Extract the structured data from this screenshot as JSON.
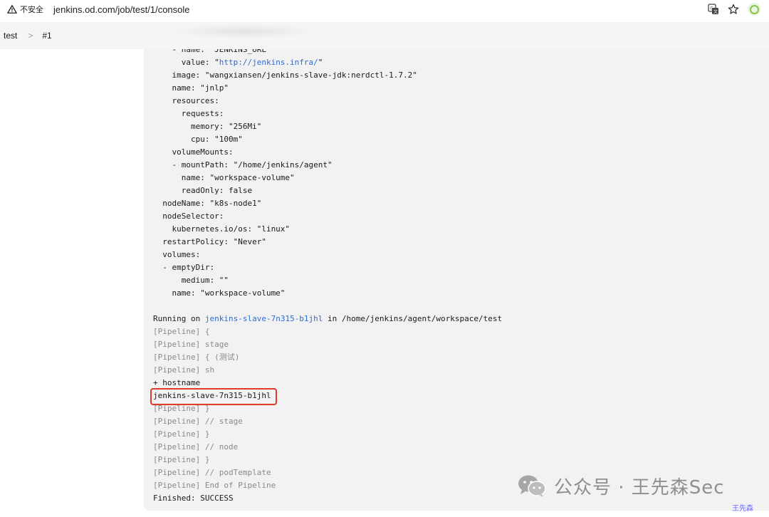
{
  "browser": {
    "security_label": "不安全",
    "url": "jenkins.od.com/job/test/1/console",
    "icons": [
      "warning-icon",
      "translate-icon",
      "star-icon",
      "profile-icon"
    ]
  },
  "breadcrumb": {
    "items": [
      "test",
      "#1"
    ],
    "separator": ">"
  },
  "console": {
    "lines": [
      {
        "text": "    - name: \"JENKINS_URL\"",
        "kind": "normal"
      },
      {
        "text_pre": "      value: \"",
        "link": "http://jenkins.infra/",
        "text_post": "\"",
        "kind": "link"
      },
      {
        "text": "    image: \"wangxiansen/jenkins-slave-jdk:nerdctl-1.7.2\"",
        "kind": "normal"
      },
      {
        "text": "    name: \"jnlp\"",
        "kind": "normal"
      },
      {
        "text": "    resources:",
        "kind": "normal"
      },
      {
        "text": "      requests:",
        "kind": "normal"
      },
      {
        "text": "        memory: \"256Mi\"",
        "kind": "normal"
      },
      {
        "text": "        cpu: \"100m\"",
        "kind": "normal"
      },
      {
        "text": "    volumeMounts:",
        "kind": "normal"
      },
      {
        "text": "    - mountPath: \"/home/jenkins/agent\"",
        "kind": "normal"
      },
      {
        "text": "      name: \"workspace-volume\"",
        "kind": "normal"
      },
      {
        "text": "      readOnly: false",
        "kind": "normal"
      },
      {
        "text": "  nodeName: \"k8s-node1\"",
        "kind": "normal"
      },
      {
        "text": "  nodeSelector:",
        "kind": "normal"
      },
      {
        "text": "    kubernetes.io/os: \"linux\"",
        "kind": "normal"
      },
      {
        "text": "  restartPolicy: \"Never\"",
        "kind": "normal"
      },
      {
        "text": "  volumes:",
        "kind": "normal"
      },
      {
        "text": "  - emptyDir:",
        "kind": "normal"
      },
      {
        "text": "      medium: \"\"",
        "kind": "normal"
      },
      {
        "text": "    name: \"workspace-volume\"",
        "kind": "normal"
      },
      {
        "text": "",
        "kind": "normal"
      },
      {
        "text_pre": "Running on ",
        "link": "jenkins-slave-7n315-b1jhl",
        "text_post": " in /home/jenkins/agent/workspace/test",
        "kind": "link"
      },
      {
        "text": "[Pipeline] {",
        "kind": "pipeline"
      },
      {
        "text": "[Pipeline] stage",
        "kind": "pipeline"
      },
      {
        "text": "[Pipeline] { (测试)",
        "kind": "pipeline"
      },
      {
        "text": "[Pipeline] sh",
        "kind": "pipeline"
      },
      {
        "text": "+ hostname",
        "kind": "normal"
      },
      {
        "text": "jenkins-slave-7n315-b1jhl",
        "kind": "highlight"
      },
      {
        "text": "[Pipeline] }",
        "kind": "pipeline"
      },
      {
        "text": "[Pipeline] // stage",
        "kind": "pipeline"
      },
      {
        "text": "[Pipeline] }",
        "kind": "pipeline"
      },
      {
        "text": "[Pipeline] // node",
        "kind": "pipeline"
      },
      {
        "text": "[Pipeline] }",
        "kind": "pipeline"
      },
      {
        "text": "[Pipeline] // podTemplate",
        "kind": "pipeline"
      },
      {
        "text": "[Pipeline] End of Pipeline",
        "kind": "pipeline"
      },
      {
        "text": "Finished: SUCCESS",
        "kind": "normal"
      }
    ]
  },
  "watermark": {
    "text": "公众号 · 王先森Sec",
    "corner": "王先森",
    "icon": "wechat-icon"
  },
  "colors": {
    "link": "#2f6bd0",
    "highlight_border": "#e03a2a",
    "pipeline_text": "#8a8a8a",
    "console_bg": "#f2f2f2"
  }
}
